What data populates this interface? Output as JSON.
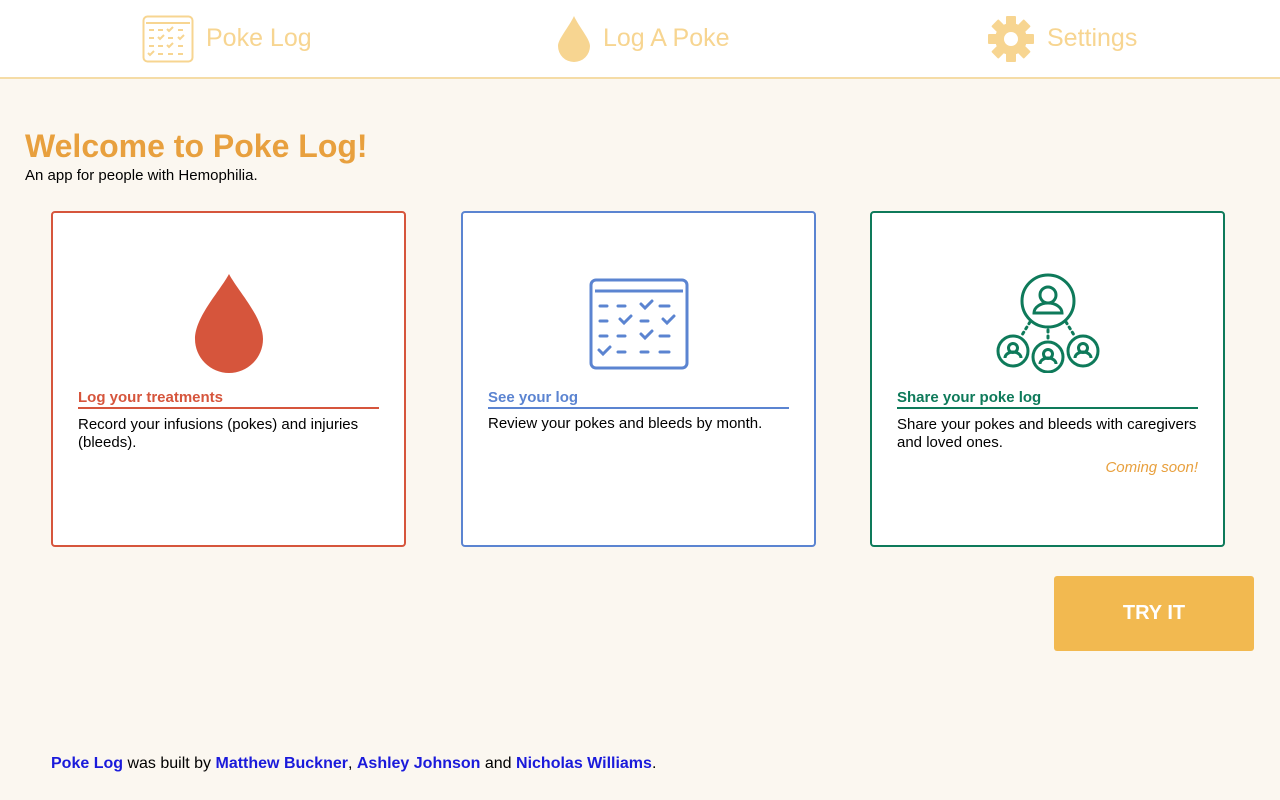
{
  "nav": {
    "items": [
      {
        "label": "Poke Log",
        "icon": "calendar-check-icon"
      },
      {
        "label": "Log A Poke",
        "icon": "drop-icon"
      },
      {
        "label": "Settings",
        "icon": "gear-icon"
      }
    ],
    "color": "#f7d591"
  },
  "welcome": {
    "title": "Welcome to Poke Log!",
    "subtitle": "An app for people with Hemophilia."
  },
  "cards": [
    {
      "title": "Log your treatments",
      "text": "Record your infusions (pokes) and injuries (bleeds).",
      "icon": "blood-drop-icon",
      "color": "#d6553c"
    },
    {
      "title": "See your log",
      "text": "Review your pokes and bleeds by month.",
      "icon": "calendar-check-icon",
      "color": "#5b84d1"
    },
    {
      "title": "Share your poke log",
      "text": "Share your pokes and bleeds with caregivers and loved ones.",
      "note": "Coming soon!",
      "icon": "share-users-icon",
      "color": "#0e7a5a"
    }
  ],
  "try_button": {
    "label": "TRY IT",
    "color": "#f2b950"
  },
  "footer": {
    "app_name": "Poke Log",
    "built_by": " was built by ",
    "authors": [
      "Matthew Buckner",
      "Ashley Johnson",
      "Nicholas Williams"
    ],
    "sep1": ", ",
    "sep2": " and ",
    "end": "."
  }
}
